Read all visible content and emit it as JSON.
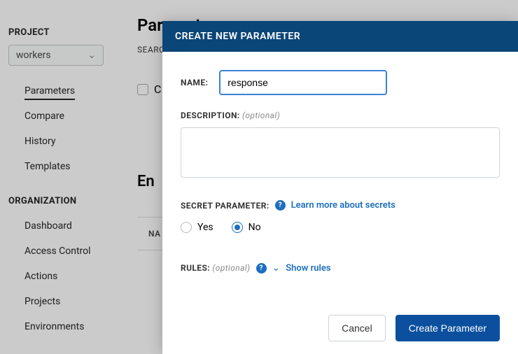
{
  "sidebar": {
    "project_section": "PROJECT",
    "project_selected": "workers",
    "project_nav": [
      {
        "label": "Parameters",
        "active": true
      },
      {
        "label": "Compare",
        "active": false
      },
      {
        "label": "History",
        "active": false
      },
      {
        "label": "Templates",
        "active": false
      }
    ],
    "org_section": "ORGANIZATION",
    "org_nav": [
      {
        "label": "Dashboard"
      },
      {
        "label": "Access Control"
      },
      {
        "label": "Actions"
      },
      {
        "label": "Projects"
      },
      {
        "label": "Environments"
      }
    ]
  },
  "main": {
    "title": "Parameters",
    "search_label": "SEARCH",
    "checkbox_partial": "C",
    "env_title_partial": "En",
    "table_head": "NA"
  },
  "modal": {
    "title": "CREATE NEW PARAMETER",
    "name_label": "NAME:",
    "name_value": "response",
    "desc_label": "DESCRIPTION:",
    "optional": "(optional)",
    "secret_label": "SECRET PARAMETER:",
    "secret_link": "Learn more about secrets",
    "radio_yes": "Yes",
    "radio_no": "No",
    "secret_selected": "No",
    "rules_label": "RULES:",
    "show_rules": "Show rules",
    "cancel": "Cancel",
    "submit": "Create Parameter"
  }
}
